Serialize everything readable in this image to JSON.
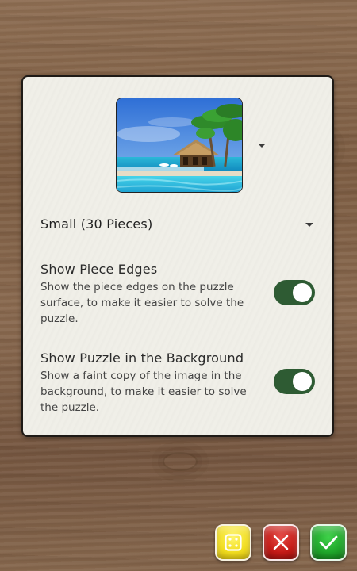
{
  "puzzle_image": {
    "icon": "beach-resort-thumbnail",
    "dropdown_icon": "caret-down-icon"
  },
  "size_select": {
    "value": "Small (30 Pieces)",
    "dropdown_icon": "caret-down-icon"
  },
  "settings": [
    {
      "title": "Show Piece Edges",
      "description": "Show the piece edges on the puzzle surface, to make it easier to solve the puzzle.",
      "enabled": true
    },
    {
      "title": "Show Puzzle in the Background",
      "description": "Show a faint copy of the image in the background, to make it easier to solve the puzzle.",
      "enabled": true
    }
  ],
  "buttons": {
    "random": {
      "icon": "dice-icon",
      "color": "#f1dd1f"
    },
    "cancel": {
      "icon": "close-icon",
      "color": "#c41b17"
    },
    "confirm": {
      "icon": "checkmark-icon",
      "color": "#1fa62a"
    }
  },
  "colors": {
    "toggle_on": "#2e5b33",
    "panel_background": "#f0efe8",
    "wood_background": "#8a6a4f"
  }
}
